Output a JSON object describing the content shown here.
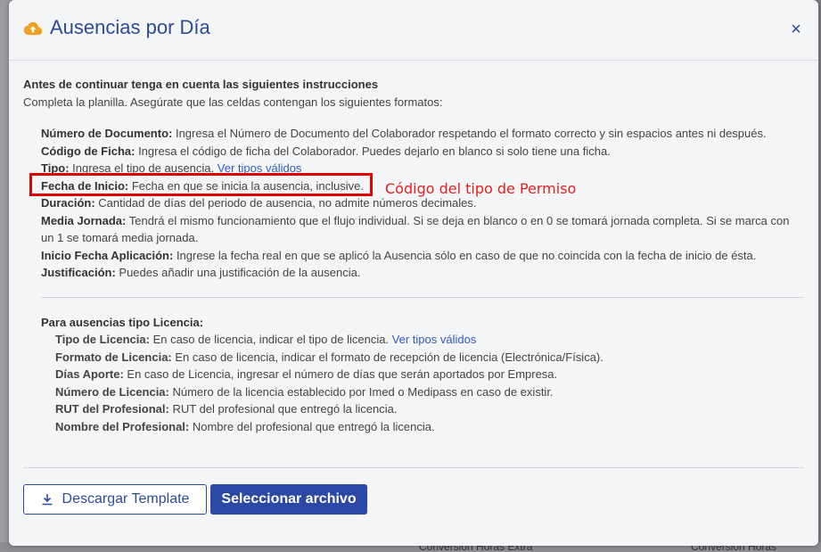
{
  "modal": {
    "title": "Ausencias por Día",
    "close_label": "×"
  },
  "intro": {
    "title": "Antes de continuar tenga en cuenta las siguientes instrucciones",
    "subtitle": "Completa la planilla. Asegúrate que las celdas contengan los siguientes formatos:"
  },
  "fields": [
    {
      "label": "Número de Documento:",
      "text": " Ingresa el Número de Documento del Colaborador respetando el formato correcto y sin espacios antes ni después."
    },
    {
      "label": "Código de Ficha:",
      "text": " Ingresa el código de ficha del Colaborador. Puedes dejarlo en blanco si solo tiene una ficha."
    },
    {
      "label": "Tipo:",
      "text": " Ingresa el tipo de ausencia. ",
      "link": "Ver tipos válidos"
    },
    {
      "label": "Fecha de Inicio:",
      "text": " Fecha en que se inicia la ausencia, inclusive."
    },
    {
      "label": "Duración:",
      "text": " Cantidad de días del periodo de ausencia, no admite números decimales."
    },
    {
      "label": "Media Jornada:",
      "text": " Tendrá el mismo funcionamiento que el flujo individual. Si se deja en blanco o en 0 se tomará jornada completa. Si se marca con un 1 se tomará media jornada."
    },
    {
      "label": "Inicio Fecha Aplicación:",
      "text": " Ingrese la fecha real en que se aplicó la Ausencia sólo en caso de que no coincida con la fecha de inicio de ésta."
    },
    {
      "label": "Justificación:",
      "text": " Puedes añadir una justificación de la ausencia."
    }
  ],
  "annotation": "Código del tipo de Permiso",
  "license": {
    "title": "Para ausencias tipo Licencia:",
    "items": [
      {
        "label": "Tipo de Licencia:",
        "text": " En caso de licencia, indicar el tipo de licencia. ",
        "link": "Ver tipos válidos"
      },
      {
        "label": "Formato de Licencia:",
        "text": " En caso de licencia, indicar el formato de recepción de licencia (Electrónica/Física)."
      },
      {
        "label": "Días Aporte:",
        "text": " En caso de Licencia, ingresar el número de días que serán aportados por Empresa."
      },
      {
        "label": "Número de Licencia:",
        "text": " Número de la licencia establecido por Imed o Medipass en caso de existir."
      },
      {
        "label": "RUT del Profesional:",
        "text": " RUT del profesional que entregó la licencia."
      },
      {
        "label": "Nombre del Profesional:",
        "text": " Nombre del profesional que entregó la licencia."
      }
    ]
  },
  "buttons": {
    "download": "Descargar Template",
    "select": "Seleccionar archivo"
  },
  "background": {
    "tab1": "Conversion Horas Extra",
    "tab2": "Conversion Horas"
  },
  "colors": {
    "accent": "#2c48a5",
    "link": "#2f5bb8",
    "annotation": "#e00000",
    "icon": "#f0a020"
  }
}
